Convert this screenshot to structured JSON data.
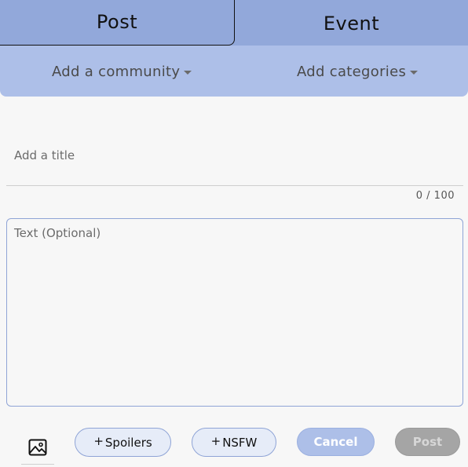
{
  "tabs": [
    {
      "label": "Post",
      "selected": true
    },
    {
      "label": "Event",
      "selected": false
    }
  ],
  "dropdowns": {
    "community": "Add a community",
    "categories": "Add categories"
  },
  "title_field": {
    "placeholder": "Add a title",
    "value": "",
    "counter": "0 / 100"
  },
  "text_field": {
    "placeholder": "Text (Optional)",
    "value": ""
  },
  "toolbar": {
    "image_icon": "image-icon",
    "spoilers_plus": "+",
    "spoilers_label": "Spoilers",
    "nsfw_plus": "+",
    "nsfw_label": "NSFW",
    "cancel_label": "Cancel",
    "post_label": "Post"
  },
  "colors": {
    "tab_bar": "#92a8da",
    "dropdown_bar": "#adbfe8",
    "accent_border": "#8fa4d6",
    "disabled_button": "#a5a5a5",
    "background": "#f7f7f7"
  }
}
